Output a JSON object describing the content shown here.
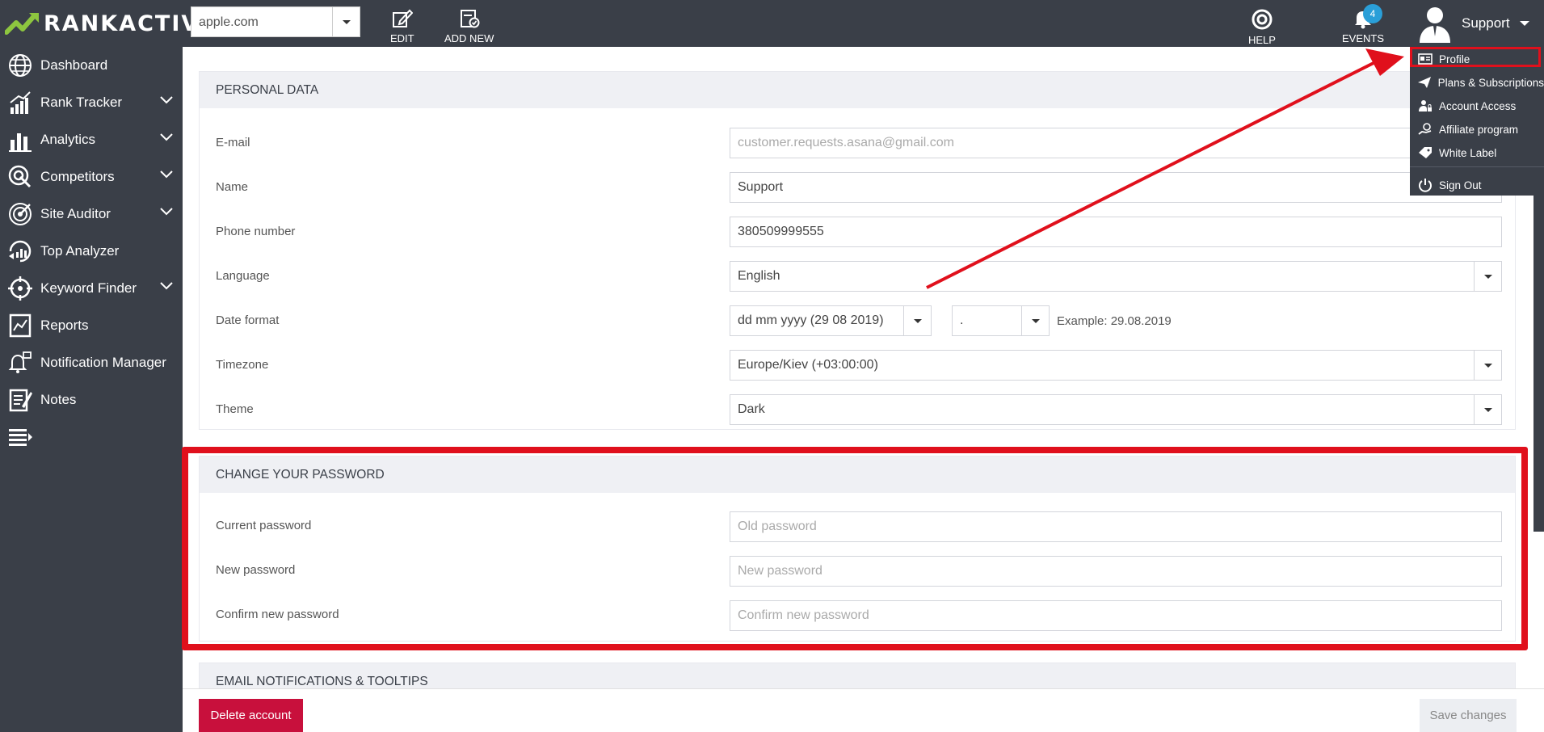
{
  "app": {
    "logo_text": "RANKACTIVE",
    "logo_color": "#8dc63f"
  },
  "topbar": {
    "domain_value": "apple.com",
    "edit_label": "EDIT",
    "add_new_label": "ADD NEW",
    "help_label": "HELP",
    "events_label": "EVENTS",
    "events_count": "4",
    "user_name": "Support"
  },
  "sidebar": {
    "items": [
      {
        "label": "Dashboard",
        "icon": "globe-icon",
        "expandable": false
      },
      {
        "label": "Rank Tracker",
        "icon": "rank-chart-icon",
        "expandable": true
      },
      {
        "label": "Analytics",
        "icon": "bar-chart-icon",
        "expandable": true
      },
      {
        "label": "Competitors",
        "icon": "target-icon",
        "expandable": true
      },
      {
        "label": "Site Auditor",
        "icon": "radar-icon",
        "expandable": true
      },
      {
        "label": "Top Analyzer",
        "icon": "analyzer-icon",
        "expandable": false
      },
      {
        "label": "Keyword Finder",
        "icon": "crosshair-icon",
        "expandable": true
      },
      {
        "label": "Reports",
        "icon": "report-icon",
        "expandable": false
      },
      {
        "label": "Notification Manager",
        "icon": "bell-icon",
        "expandable": false
      },
      {
        "label": "Notes",
        "icon": "notes-icon",
        "expandable": false
      }
    ]
  },
  "personal": {
    "title": "PERSONAL DATA",
    "email_label": "E-mail",
    "email_value": "customer.requests.asana@gmail.com",
    "name_label": "Name",
    "name_value": "Support",
    "phone_label": "Phone number",
    "phone_value": "380509999555",
    "language_label": "Language",
    "language_value": "English",
    "date_format_label": "Date format",
    "date_format_value": "dd mm yyyy (29 08 2019)",
    "date_separator_value": ".",
    "date_example": "Example: 29.08.2019",
    "timezone_label": "Timezone",
    "timezone_value": "Europe/Kiev (+03:00:00)",
    "theme_label": "Theme",
    "theme_value": "Dark"
  },
  "password": {
    "title": "CHANGE YOUR PASSWORD",
    "current_label": "Current password",
    "current_placeholder": "Old password",
    "new_label": "New password",
    "new_placeholder": "New password",
    "confirm_label": "Confirm new password",
    "confirm_placeholder": "Confirm new password"
  },
  "notifications": {
    "title": "EMAIL NOTIFICATIONS & TOOLTIPS"
  },
  "buttons": {
    "delete": "Delete account",
    "save": "Save changes"
  },
  "user_menu": {
    "items": [
      {
        "label": "Profile",
        "icon": "id-card-icon"
      },
      {
        "label": "Plans & Subscriptions",
        "icon": "paper-plane-icon"
      },
      {
        "label": "Account Access",
        "icon": "user-lock-icon"
      },
      {
        "label": "Affiliate program",
        "icon": "hand-coin-icon"
      },
      {
        "label": "White Label",
        "icon": "tag-icon"
      },
      {
        "label": "Sign Out",
        "icon": "power-icon"
      }
    ]
  },
  "colors": {
    "sidebar_bg": "#3a3f48",
    "accent_red": "#e0101c",
    "delete_red": "#c8103c",
    "badge_blue": "#2a9fd8"
  }
}
